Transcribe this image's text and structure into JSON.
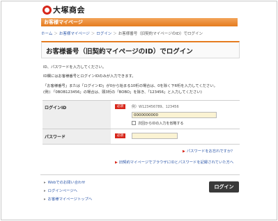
{
  "brand": {
    "name": "大塚商会"
  },
  "header": {
    "section_label": "お客様マイページ"
  },
  "breadcrumb": [
    "ホーム",
    "お客様マイページ",
    "ログイン",
    "お客様番号（旧契約マイページのID）でログイン"
  ],
  "page": {
    "title": "お客様番号（旧契約マイページのID）でログイン",
    "instructions": [
      "ID、パスワードを入力してください。",
      "ID欄にはお客様番号とログインIDのみが入力できます。",
      "「お客様番号」または「ログインID」が0から始まる10桁の場合は、0を除く下6桁を入力してください。",
      "(例)：「0BOB123456」の場合は、頭3桁の「BOBO」を除き、「123456」と入力してください)"
    ]
  },
  "form": {
    "login_id": {
      "label": "ログインID",
      "required": "必須",
      "example": "例）W123456789、123456",
      "value": "0000000000",
      "remember_label": "次回からIDの入力を省略する"
    },
    "password": {
      "label": "パスワード",
      "required": "必須",
      "value": ""
    }
  },
  "links": {
    "forgot_password": "パスワードをお忘れですか？",
    "id_password_record": "旧契約マイページでブラウザにIDとパスワードを記録されていた方へ",
    "web_inquiry": "Webでのお問い合わせ",
    "login_page": "ログインページへ",
    "mypage_top": "お客様マイページトップへ"
  },
  "buttons": {
    "login": "ログイン"
  },
  "colors": {
    "accent": "#e57b1f",
    "required": "#d7261a",
    "link": "#2a55a8",
    "input_bg": "#fbf3d3"
  }
}
